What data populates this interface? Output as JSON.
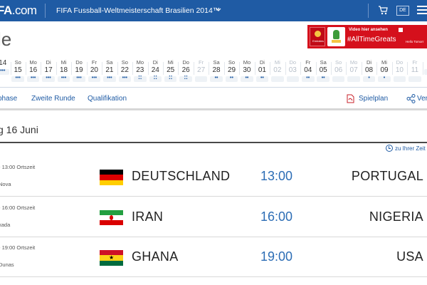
{
  "header": {
    "logo_prefix": "FA",
    "logo_suffix": ".com",
    "event_title": "FIFA Fussball-Weltmeisterschaft Brasilien 2014™",
    "lang": "DE",
    "page_title": "le"
  },
  "ad": {
    "brand": "Emirates",
    "video_text": "Video hier ansehen",
    "hashtag": "#AllTimeGreats",
    "tagline": "Hello Tomorr",
    "brand_color": "#d5101c"
  },
  "dates": [
    {
      "wd": "",
      "dn": "14",
      "faded": false,
      "dots": "•••"
    },
    {
      "wd": "So",
      "dn": "15",
      "faded": false,
      "dots": "•••"
    },
    {
      "wd": "Mo",
      "dn": "16",
      "faded": false,
      "dots": "•••"
    },
    {
      "wd": "Di",
      "dn": "17",
      "faded": false,
      "dots": "•••"
    },
    {
      "wd": "Mi",
      "dn": "18",
      "faded": false,
      "dots": "•••"
    },
    {
      "wd": "Do",
      "dn": "19",
      "faded": false,
      "dots": "•••"
    },
    {
      "wd": "Fr",
      "dn": "20",
      "faded": false,
      "dots": "•••"
    },
    {
      "wd": "Sa",
      "dn": "21",
      "faded": false,
      "dots": "•••"
    },
    {
      "wd": "So",
      "dn": "22",
      "faded": false,
      "dots": "•••"
    },
    {
      "wd": "Mo",
      "dn": "23",
      "faded": false,
      "dots": "⁚⁚"
    },
    {
      "wd": "Di",
      "dn": "24",
      "faded": false,
      "dots": "⁚⁚"
    },
    {
      "wd": "Mi",
      "dn": "25",
      "faded": false,
      "dots": "⁚⁚"
    },
    {
      "wd": "Do",
      "dn": "26",
      "faded": false,
      "dots": "⁚⁚"
    },
    {
      "wd": "Fr",
      "dn": "27",
      "faded": true,
      "dots": ""
    },
    {
      "wd": "Sa",
      "dn": "28",
      "faded": false,
      "dots": "••"
    },
    {
      "wd": "So",
      "dn": "29",
      "faded": false,
      "dots": "••"
    },
    {
      "wd": "Mo",
      "dn": "30",
      "faded": false,
      "dots": "••"
    },
    {
      "wd": "Di",
      "dn": "01",
      "faded": false,
      "dots": "••"
    },
    {
      "wd": "Mi",
      "dn": "02",
      "faded": true,
      "dots": ""
    },
    {
      "wd": "Do",
      "dn": "03",
      "faded": true,
      "dots": ""
    },
    {
      "wd": "Fr",
      "dn": "04",
      "faded": false,
      "dots": "••"
    },
    {
      "wd": "Sa",
      "dn": "05",
      "faded": false,
      "dots": "••"
    },
    {
      "wd": "So",
      "dn": "06",
      "faded": true,
      "dots": ""
    },
    {
      "wd": "Mo",
      "dn": "07",
      "faded": true,
      "dots": ""
    },
    {
      "wd": "Di",
      "dn": "08",
      "faded": false,
      "dots": "•"
    },
    {
      "wd": "Mi",
      "dn": "09",
      "faded": false,
      "dots": "•"
    },
    {
      "wd": "Do",
      "dn": "10",
      "faded": true,
      "dots": ""
    },
    {
      "wd": "Fr",
      "dn": "11",
      "faded": true,
      "dots": ""
    },
    {
      "wd": "",
      "dn": "1",
      "faded": true,
      "dots": ""
    }
  ],
  "tabs": {
    "group_phase": "phase",
    "second_round": "Zweite Runde",
    "qualification": "Qualifikation",
    "schedule": "Spielplan",
    "share": "Ver"
  },
  "section": {
    "date_label": "g 16 Juni",
    "timezone_link": "zu Ihrer Zeit"
  },
  "matches": [
    {
      "meta": "- 13:00 Ortszeit",
      "venue": "Nova",
      "home": "DEUTSCHLAND",
      "time": "13:00",
      "away": "PORTUGAL",
      "flag": "germany"
    },
    {
      "meta": "- 16:00 Ortszeit",
      "venue": "xada",
      "home": "IRAN",
      "time": "16:00",
      "away": "NIGERIA",
      "flag": "iran"
    },
    {
      "meta": "- 19:00 Ortszeit",
      "venue": "Dunas",
      "home": "GHANA",
      "time": "19:00",
      "away": "USA",
      "flag": "ghana"
    }
  ],
  "colors": {
    "topbar": "#1f5ba4",
    "link": "#1f5ba4",
    "time": "#2c6db5"
  }
}
